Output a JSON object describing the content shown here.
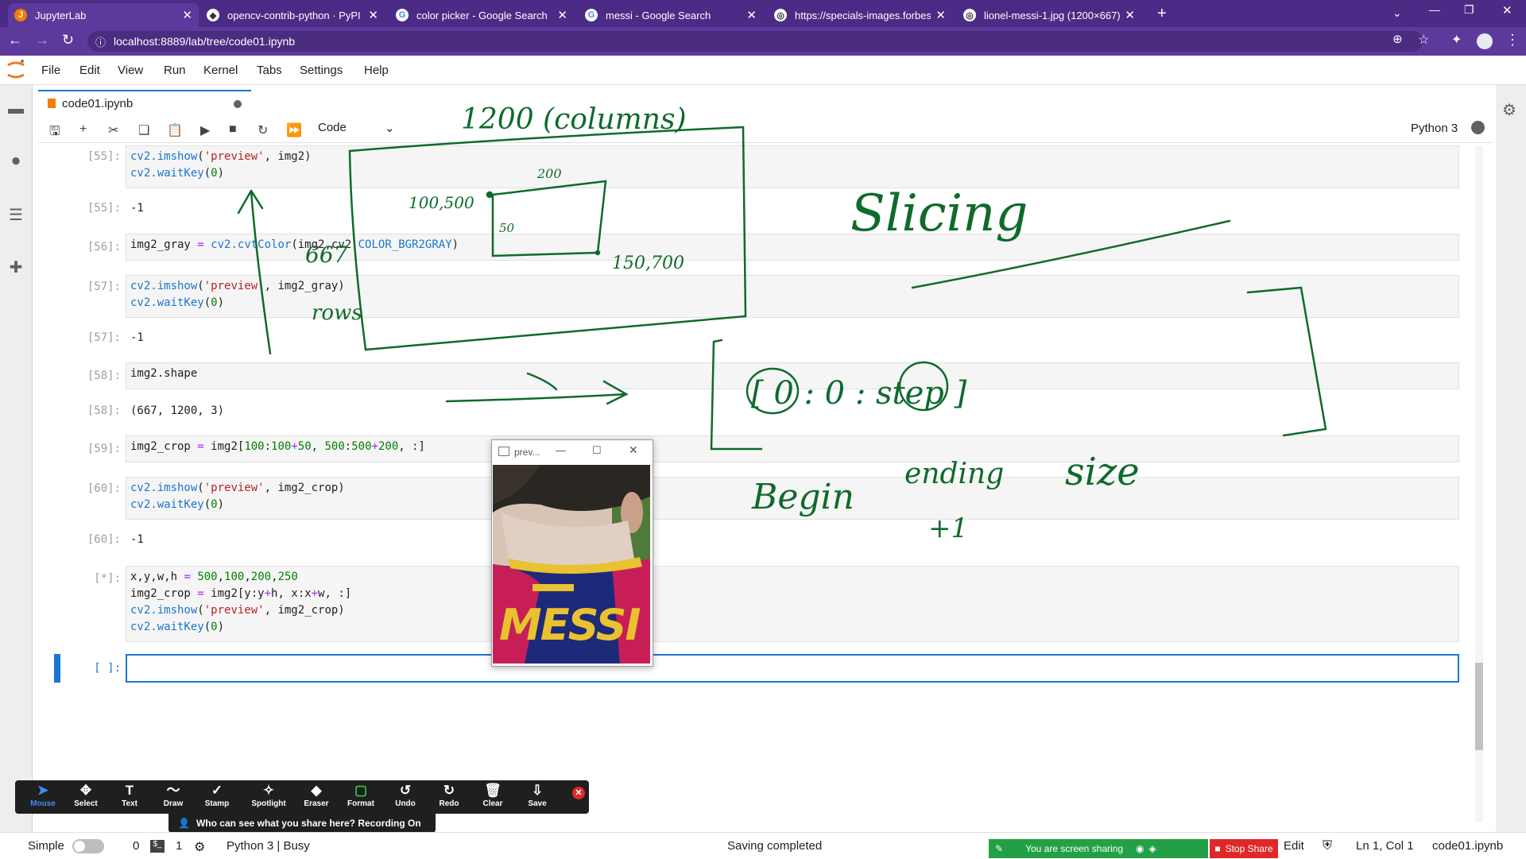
{
  "browser": {
    "tabs": [
      {
        "title": "JupyterLab",
        "active": true
      },
      {
        "title": "opencv-contrib-python · PyPI",
        "active": false
      },
      {
        "title": "color picker - Google Search",
        "active": false
      },
      {
        "title": "messi - Google Search",
        "active": false
      },
      {
        "title": "https://specials-images.forbesim",
        "active": false
      },
      {
        "title": "lionel-messi-1.jpg (1200×667)",
        "active": false
      }
    ],
    "url": "localhost:8889/lab/tree/code01.ipynb"
  },
  "jupyter": {
    "menu": [
      "File",
      "Edit",
      "View",
      "Run",
      "Kernel",
      "Tabs",
      "Settings",
      "Help"
    ],
    "doc_tab": "code01.ipynb",
    "cell_type": "Code",
    "kernel": "Python 3",
    "cells": [
      {
        "prompt": "[55]:",
        "kind": "in",
        "lines": [
          "cv2.imshow('preview', img2)",
          "cv2.waitKey(0)"
        ]
      },
      {
        "prompt": "[55]:",
        "kind": "out",
        "text": "-1"
      },
      {
        "prompt": "[56]:",
        "kind": "in",
        "lines": [
          "img2_gray = cv2.cvtColor(img2,cv2.COLOR_BGR2GRAY)"
        ]
      },
      {
        "prompt": "[57]:",
        "kind": "in",
        "lines": [
          "cv2.imshow('preview', img2_gray)",
          "cv2.waitKey(0)"
        ]
      },
      {
        "prompt": "[57]:",
        "kind": "out",
        "text": "-1"
      },
      {
        "prompt": "[58]:",
        "kind": "in",
        "lines": [
          "img2.shape"
        ]
      },
      {
        "prompt": "[58]:",
        "kind": "out",
        "text": "(667, 1200, 3)"
      },
      {
        "prompt": "[59]:",
        "kind": "in",
        "lines": [
          "img2_crop = img2[100:100+50, 500:500+200, :]"
        ]
      },
      {
        "prompt": "[60]:",
        "kind": "in",
        "lines": [
          "cv2.imshow('preview', img2_crop)",
          "cv2.waitKey(0)"
        ]
      },
      {
        "prompt": "[60]:",
        "kind": "out",
        "text": "-1"
      },
      {
        "prompt": "[*]:",
        "kind": "in",
        "lines": [
          "x,y,w,h = 500,100,200,250",
          "img2_crop = img2[y:y+h, x:x+w, :]",
          "cv2.imshow('preview', img2_crop)",
          "cv2.waitKey(0)"
        ]
      },
      {
        "prompt": "[ ]:",
        "kind": "in",
        "lines": [
          ""
        ]
      }
    ]
  },
  "preview_window": {
    "title": "prev...",
    "jersey_text": "MESSI"
  },
  "annotations": {
    "handwriting": [
      "1200 (columns)",
      "200",
      "100,500",
      "50",
      "150,700",
      "667",
      "rows",
      "Slicing",
      "[ 0 : 0 : step ]",
      "Begin",
      "ending",
      "+1",
      "size"
    ]
  },
  "zoom": {
    "tools": [
      "Mouse",
      "Select",
      "Text",
      "Draw",
      "Stamp",
      "Spotlight",
      "Eraser",
      "Format",
      "Undo",
      "Redo",
      "Clear",
      "Save"
    ],
    "tip": "Who can see what you share here? Recording On"
  },
  "status": {
    "mode_label": "Simple",
    "count_a": "0",
    "count_b": "1",
    "kernel_status": "Python 3 | Busy",
    "save_status": "Saving completed",
    "sharing": "You are screen sharing",
    "stop_share": "Stop Share",
    "edit_mode": "Edit",
    "cursor": "Ln 1, Col 1",
    "file": "code01.ipynb"
  }
}
